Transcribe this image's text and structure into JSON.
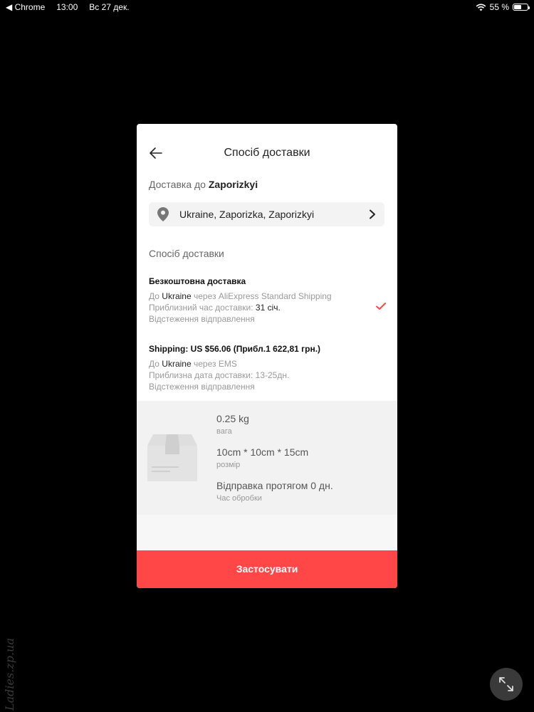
{
  "status_bar": {
    "back_app": "◀ Chrome",
    "time": "13:00",
    "date": "Вс 27 дек.",
    "battery_percent": "55 %",
    "battery_level": 0.55
  },
  "modal": {
    "title": "Спосіб доставки",
    "destination_prefix": "Доставка до ",
    "destination_city": "Zaporizkyi",
    "address": "Ukraine, Zaporizka, Zaporizkyi",
    "section_label": "Спосіб доставки",
    "options": [
      {
        "title": "Безкоштовна доставка",
        "to_prefix": "До ",
        "country": "Ukraine",
        "via": " через AliExpress Standard Shipping",
        "time_label": "Приблизний час доставки: ",
        "time_value": "31  січ.",
        "tracking": "Відстеження відправлення",
        "selected": true
      },
      {
        "title": "Shipping: US $56.06 (Прибл.1 622,81 грн.)",
        "to_prefix": "До ",
        "country": "Ukraine",
        "via": " через EMS",
        "time_line": "Приблизна дата доставки: 13-25дн.",
        "tracking": "Відстеження відправлення",
        "selected": false
      }
    ],
    "package": {
      "weight_value": "0.25 kg",
      "weight_label": "вага",
      "size_value": "10cm * 10cm * 15cm",
      "size_label": "розмір",
      "dispatch_value": "Відправка протягом 0 дн.",
      "dispatch_label": "Час обробки"
    },
    "apply_label": "Застосувати"
  },
  "watermark": "Ladies.zp.ua",
  "colors": {
    "accent": "#ff4747",
    "background": "#000000",
    "panel": "#f2f2f2"
  },
  "icons": [
    "back-arrow-icon",
    "location-pin-icon",
    "chevron-right-icon",
    "checkmark-icon",
    "package-box-icon",
    "expand-icon",
    "wifi-icon",
    "battery-icon"
  ]
}
